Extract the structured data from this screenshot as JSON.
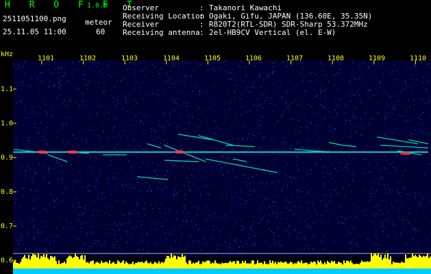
{
  "header": {
    "brand": "H R O F F T",
    "version": "1.0.0",
    "filename": "2511051100.png",
    "timestamp": "25.11.05 11:00",
    "detect_label": "meteor",
    "detect_count": "60"
  },
  "info": [
    {
      "label": "Observer",
      "value": "Takanori Kawachi"
    },
    {
      "label": "Receiving Location",
      "value": "Ogaki, Gifu, JAPAN (136.60E, 35.35N)"
    },
    {
      "label": "Receiver",
      "value": "R820T2(RTL-SDR) SDR-Sharp 53.372MHz"
    },
    {
      "label": "Receiving antenna",
      "value": "2el-HB9CV Vertical (el. E-W)"
    }
  ],
  "colon": ":",
  "spectrogram": {
    "unit_label": "kHz",
    "time_ticks": [
      "1101",
      "1102",
      "1103",
      "1104",
      "1105",
      "1106",
      "1107",
      "1108",
      "1109",
      "1110"
    ],
    "freq_ticks": [
      "1.1",
      "1.0",
      "0.9",
      "0.8",
      "0.7",
      "0.6"
    ],
    "colors": {
      "background": "#000033",
      "signal": "#00ffff",
      "peak": "#ff3333",
      "tick": "#ffff00",
      "level_bar": "#ffff00",
      "base": "#00ccff"
    }
  }
}
